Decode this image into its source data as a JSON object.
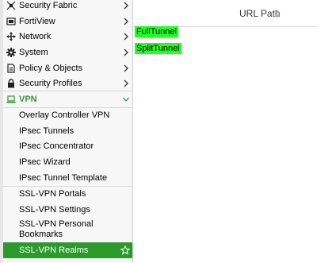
{
  "sidebar": {
    "items": [
      {
        "label": "Security Fabric",
        "icon": "security-fabric-icon"
      },
      {
        "label": "FortiView",
        "icon": "fortiview-icon"
      },
      {
        "label": "Network",
        "icon": "network-icon"
      },
      {
        "label": "System",
        "icon": "gear-icon"
      },
      {
        "label": "Policy & Objects",
        "icon": "policy-icon"
      },
      {
        "label": "Security Profiles",
        "icon": "lock-icon"
      },
      {
        "label": "VPN",
        "icon": "laptop-icon",
        "expanded": true
      }
    ],
    "vpn_subitems": [
      "Overlay Controller VPN",
      "IPsec Tunnels",
      "IPsec Concentrator",
      "IPsec Wizard",
      "IPsec Tunnel Template",
      "SSL-VPN Portals",
      "SSL-VPN Settings",
      "SSL-VPN Personal Bookmarks"
    ],
    "active_item": "SSL-VPN Realms"
  },
  "table": {
    "column": "URL Path",
    "rows": [
      "FullTunnel",
      "SplitTunnel"
    ]
  },
  "colors": {
    "active_bg": "#2a9a2a",
    "vpn_accent": "#2f9a2f",
    "row_highlight": "#22ff22",
    "sidebar_bg": "#f7f7f7"
  }
}
